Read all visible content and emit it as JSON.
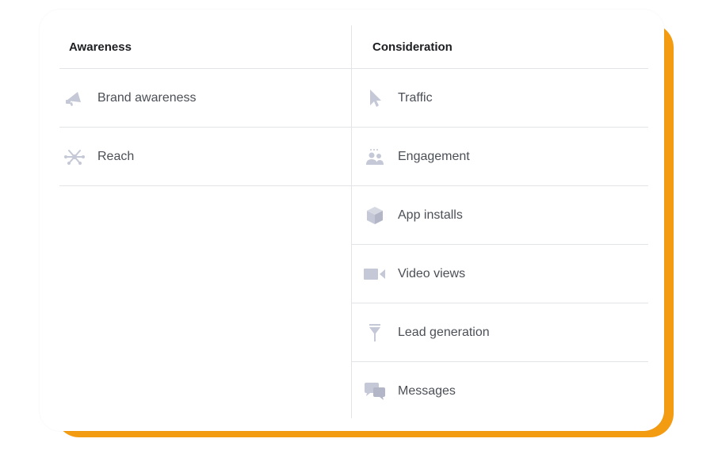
{
  "columns": {
    "awareness": {
      "title": "Awareness",
      "items": [
        {
          "label": "Brand awareness",
          "icon": "megaphone-icon"
        },
        {
          "label": "Reach",
          "icon": "reach-icon"
        }
      ]
    },
    "consideration": {
      "title": "Consideration",
      "items": [
        {
          "label": "Traffic",
          "icon": "cursor-icon"
        },
        {
          "label": "Engagement",
          "icon": "people-icon"
        },
        {
          "label": "App installs",
          "icon": "box-icon"
        },
        {
          "label": "Video views",
          "icon": "video-camera-icon"
        },
        {
          "label": "Lead generation",
          "icon": "funnel-icon"
        },
        {
          "label": "Messages",
          "icon": "chat-bubbles-icon"
        }
      ]
    }
  },
  "colors": {
    "accent_shadow": "#f39c12",
    "icon": "#c5c8d6",
    "text": "#4b4f56",
    "divider": "#e3e4e8"
  }
}
